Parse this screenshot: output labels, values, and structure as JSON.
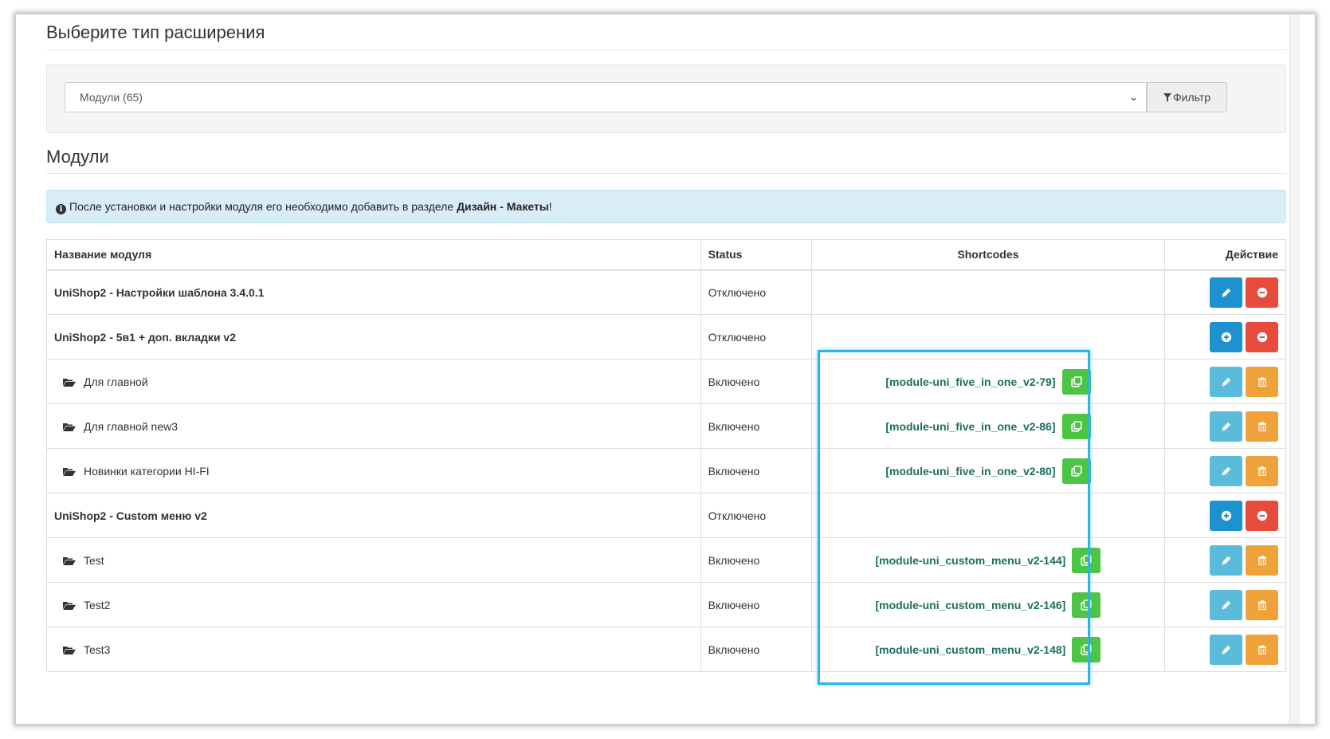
{
  "page": {
    "title": "Выберите тип расширения"
  },
  "filter": {
    "selected": "Модули (65)",
    "button_label": "Фильтр"
  },
  "section": {
    "title": "Модули"
  },
  "alert": {
    "text_before": "После установки и настройки модуля его необходимо добавить в разделе ",
    "text_bold": "Дизайн - Макеты",
    "text_after": "!"
  },
  "table": {
    "headers": {
      "name": "Название модуля",
      "status": "Status",
      "shortcodes": "Shortcodes",
      "action": "Действие"
    },
    "rows": [
      {
        "type": "parent",
        "name": "UniShop2 - Настройки шаблона 3.4.0.1",
        "status": "Отключено",
        "shortcode": "",
        "actions": [
          "edit",
          "uninstall"
        ]
      },
      {
        "type": "parent",
        "name": "UniShop2 - 5в1 + доп. вкладки v2",
        "status": "Отключено",
        "shortcode": "",
        "actions": [
          "add",
          "uninstall"
        ]
      },
      {
        "type": "child",
        "name": "Для главной",
        "status": "Включено",
        "shortcode": "[module-uni_five_in_one_v2-79]",
        "actions": [
          "edit",
          "delete"
        ]
      },
      {
        "type": "child",
        "name": "Для главной new3",
        "status": "Включено",
        "shortcode": "[module-uni_five_in_one_v2-86]",
        "actions": [
          "edit",
          "delete"
        ]
      },
      {
        "type": "child",
        "name": "Новинки категории HI-FI",
        "status": "Включено",
        "shortcode": "[module-uni_five_in_one_v2-80]",
        "actions": [
          "edit",
          "delete"
        ]
      },
      {
        "type": "parent",
        "name": "UniShop2 - Custom меню v2",
        "status": "Отключено",
        "shortcode": "",
        "actions": [
          "add",
          "uninstall"
        ]
      },
      {
        "type": "child",
        "name": "Test",
        "status": "Включено",
        "shortcode": "[module-uni_custom_menu_v2-144]",
        "actions": [
          "edit",
          "delete"
        ]
      },
      {
        "type": "child",
        "name": "Test2",
        "status": "Включено",
        "shortcode": "[module-uni_custom_menu_v2-146]",
        "actions": [
          "edit",
          "delete"
        ]
      },
      {
        "type": "child",
        "name": "Test3",
        "status": "Включено",
        "shortcode": "[module-uni_custom_menu_v2-148]",
        "actions": [
          "edit",
          "delete"
        ]
      }
    ]
  },
  "colors": {
    "shortcode_text": "#1a6f5e",
    "copy_button": "#4cc545",
    "primary_button": "#1e91cf",
    "info_button": "#5bbbdb",
    "danger_button": "#e64b3c",
    "warning_button": "#f0a23a",
    "highlight_border": "#2bb4e6"
  },
  "icons": {
    "filter": "filter-icon",
    "info": "info-circle-icon",
    "folder": "folder-open-icon",
    "copy": "copy-icon",
    "edit": "pencil-icon",
    "add": "plus-circle-icon",
    "uninstall": "minus-circle-icon",
    "delete": "trash-icon",
    "dropdown": "chevron-down-icon"
  }
}
